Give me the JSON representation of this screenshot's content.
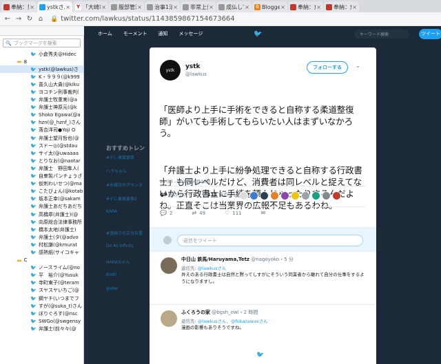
{
  "browser": {
    "tabs": [
      {
        "label": "奉納：奴",
        "color": "#c0392b",
        "icon": "news-icon"
      },
      {
        "label": "ystkさんは",
        "color": "#1da1f2",
        "icon": "twitter-icon"
      },
      {
        "label": "「大崎事件",
        "color": "#6001d2",
        "icon": "yahoo-icon"
      },
      {
        "label": "服部管法",
        "color": "#888888",
        "icon": "page-icon"
      },
      {
        "label": "治事1法道",
        "color": "#888888",
        "icon": "page-icon"
      },
      {
        "label": "非常上告",
        "color": "#888888",
        "icon": "page-icon"
      },
      {
        "label": "成仏して",
        "color": "#888888",
        "icon": "page-icon"
      },
      {
        "label": "Blogger：",
        "color": "#f57d00",
        "icon": "blogger-icon"
      },
      {
        "label": "奉納：危",
        "color": "#c0392b",
        "icon": "news-icon"
      },
      {
        "label": "奉納：危",
        "color": "#c0392b",
        "icon": "news-icon"
      }
    ],
    "url": "twitter.com/lawkus/status/1143859867154673664"
  },
  "sidebar": {
    "search_placeholder": "ブックマークを検索",
    "items": [
      {
        "label": "小倉秀夫@Hidec",
        "type": "link"
      },
      {
        "label": "8",
        "type": "folder"
      },
      {
        "label": "ystk(@lawkus)さ",
        "type": "link",
        "selected": true
      },
      {
        "label": "K・９９９(@k999",
        "type": "link"
      },
      {
        "label": "喜久山大貴(@kiku",
        "type": "link"
      },
      {
        "label": "ヨコチン刑事裁判(",
        "type": "link"
      },
      {
        "label": "弁護士牧重実(@a",
        "type": "link"
      },
      {
        "label": "弁護士神原元(@k",
        "type": "link"
      },
      {
        "label": "Shoko Egawa(@a",
        "type": "link"
      },
      {
        "label": "hzn(@_hznf_)さん",
        "type": "link"
      },
      {
        "label": "落合洋司●Yoji O",
        "type": "link"
      },
      {
        "label": "弁護士望月哲也(@",
        "type": "link"
      },
      {
        "label": "スドー◎(@stdau",
        "type": "link"
      },
      {
        "label": "サイ太(@uwaaaa",
        "type": "link"
      },
      {
        "label": "とりなお(@naotar",
        "type": "link"
      },
      {
        "label": "弁護士　野田隼人(",
        "type": "link"
      },
      {
        "label": "自衆製パンチょうざ",
        "type": "link"
      },
      {
        "label": "仮刺わいせつ(@ma",
        "type": "link"
      },
      {
        "label": "こたびょん(@kotab",
        "type": "link"
      },
      {
        "label": "坂本正幸(@sakam",
        "type": "link"
      },
      {
        "label": "弁護士あだちあだち",
        "type": "link"
      },
      {
        "label": "高橋章(弁護士)(@",
        "type": "link"
      },
      {
        "label": "向原総合法律事務所",
        "type": "link"
      },
      {
        "label": "橋本太地(弁護士)",
        "type": "link"
      },
      {
        "label": "弁護士(タ(@advo",
        "type": "link"
      },
      {
        "label": "村松謙(@kmurat",
        "type": "link"
      },
      {
        "label": "感熱紙(サイコキャ",
        "type": "link"
      },
      {
        "label": "C",
        "type": "folder"
      },
      {
        "label": "ノースライム(@no",
        "type": "link"
      },
      {
        "label": "平　裕介(@Yusuk",
        "type": "link"
      },
      {
        "label": "寺町東子(@teram",
        "type": "link"
      },
      {
        "label": "スヤスヤいちご(@",
        "type": "link"
      },
      {
        "label": "鋼ヤチ(いつまでフ",
        "type": "link"
      },
      {
        "label": "すが(@suka_t)さん",
        "type": "link"
      },
      {
        "label": "ぼりぐろす(@nsc",
        "type": "link"
      },
      {
        "label": "SWGo(@swgensy",
        "type": "link"
      },
      {
        "label": "弁護士(前々々(@",
        "type": "link"
      }
    ]
  },
  "twitter_nav": {
    "home": "ホーム",
    "moments": "モーメント",
    "notifications": "通知",
    "messages": "メッセージ",
    "search_placeholder": "キーワード検索",
    "tweet_button": "ツイート"
  },
  "background": {
    "trends_title": "おすすめトレン",
    "trends": [
      "#デレ東家宴祭",
      "ハラちゃん",
      "#水曜日のダウンタ",
      "#デレ東家宴祭2",
      "KARA",
      "#漫画での立ち位置",
      "Do As Infinity",
      "HARAちゃん",
      "KinKi",
      "globe"
    ]
  },
  "modal": {
    "user_name": "ystk",
    "user_handle": "@lawkus",
    "avatar_text": "ystk",
    "follow_label": "フォローする",
    "tweet_line1": "「医師より上手に手術をできると自称する柔道整復師」がいても手術してもらいたい人はまずいなかろう。",
    "tweet_line2": "「弁護士より上手に紛争処理できると自称する行政書士」も同レベルだけど、消費者は同レベルと捉えてないから行政書士に手続を頼んじゃったりするんだよね。正直そこは当業界の広報不足もあるわね。",
    "timestamp": "21:33 - 2019年6月26日",
    "retweets_count": "49",
    "retweets_label": "件のリツイート",
    "likes_count": "111",
    "likes_label": "件のいいね",
    "reply_count": "2",
    "retweet_count_action": "49",
    "like_count_action": "111",
    "reply_placeholder": "返信をツイート"
  },
  "replies": [
    {
      "name": "中日山 鉄馬/Haruyama,Tetz",
      "handle": "@nagoyoko",
      "time": "・5 分",
      "to_label": "返信先:",
      "to_users": "@lawkusさん",
      "body": "弁えのある行政書士は自然と黙ってしすがにそういう同業者から離れて自分の仕事をするようになりますし。",
      "avatar_color": "#7a6a5a"
    },
    {
      "name": "ふくろうの家",
      "handle": "@bgsh_owl",
      "time": "・2 時間",
      "to_label": "返信先:",
      "to_users": "@lawkusさん、@fukazawasさん",
      "body": "漫画の影響もありそうですね。",
      "avatar_color": "#b9a98a"
    }
  ]
}
